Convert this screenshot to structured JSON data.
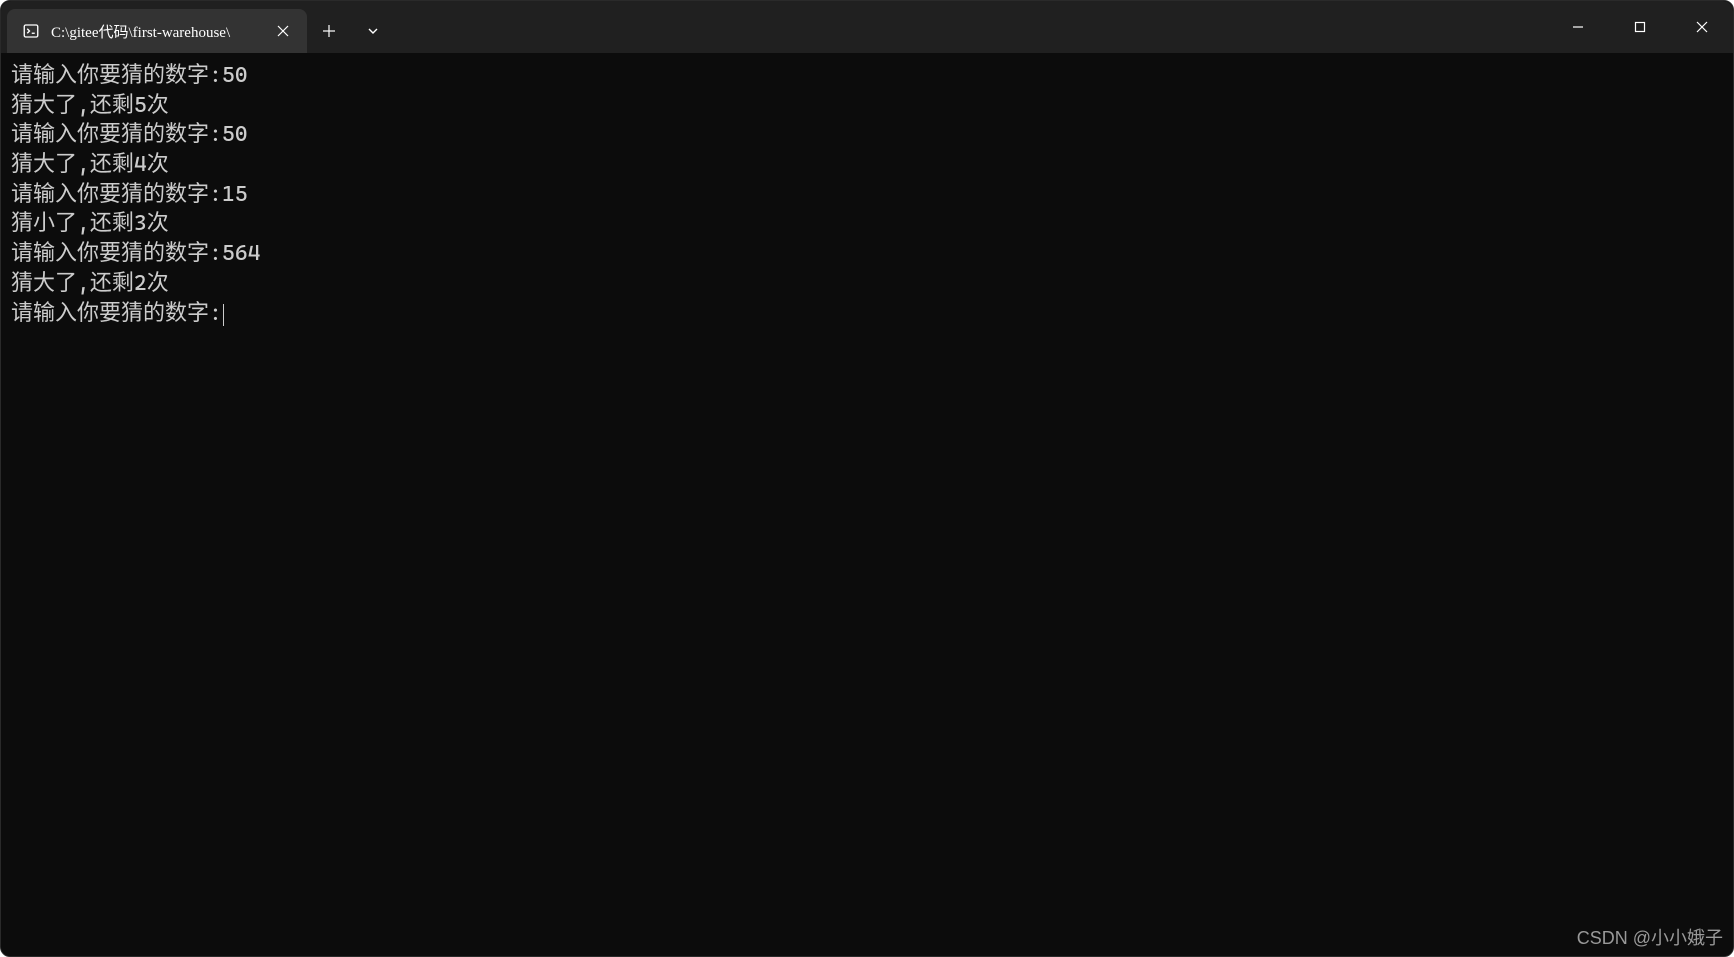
{
  "window": {
    "tab_title": "C:\\gitee代码\\first-warehouse\\",
    "icons": {
      "terminal": "terminal-icon",
      "close_tab": "close-icon",
      "new_tab": "plus-icon",
      "chevron": "chevron-down-icon",
      "minimize": "minimize-icon",
      "maximize": "maximize-icon",
      "close_window": "close-icon"
    }
  },
  "terminal": {
    "lines": [
      "请输入你要猜的数字:50",
      "猜大了,还剩5次",
      "请输入你要猜的数字:50",
      "猜大了,还剩4次",
      "请输入你要猜的数字:15",
      "猜小了,还剩3次",
      "请输入你要猜的数字:564",
      "猜大了,还剩2次",
      "请输入你要猜的数字:"
    ]
  },
  "watermark": "CSDN @小小娥子"
}
